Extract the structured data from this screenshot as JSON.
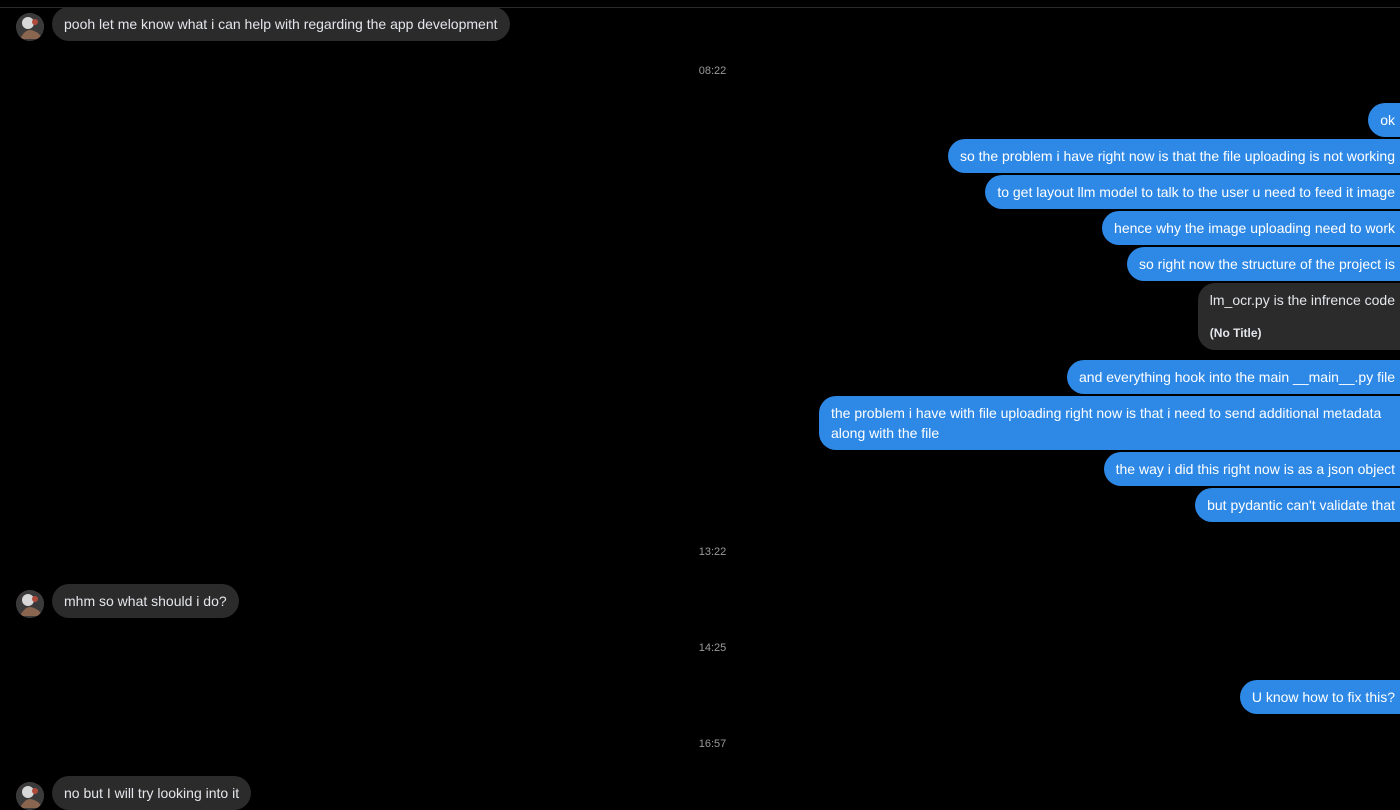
{
  "messages": [
    {
      "text": "pooh let me know what i can help with regarding the app development"
    },
    {
      "text": "ok"
    },
    {
      "text": "so the problem i have right now is that the file uploading is not working"
    },
    {
      "text": "to get layout llm model to talk to the user u need to feed it image"
    },
    {
      "text": "hence why the image uploading need to work"
    },
    {
      "text": "so right now the structure of the project is"
    },
    {
      "text": "lm_ocr.py is the infrence code",
      "attachment_title": "(No Title)"
    },
    {
      "text": "and everything hook into the main __main__.py file"
    },
    {
      "text": "the problem i have with file uploading right now is that i need to send additional metadata along with the file"
    },
    {
      "text": "the way i did this right now is as a json object"
    },
    {
      "text": "but pydantic can't validate that"
    },
    {
      "text": "mhm so what should i do?"
    },
    {
      "text": "U know how to fix this?"
    },
    {
      "text": "no but I will try looking into it"
    }
  ],
  "timestamps": [
    "08:22",
    "13:22",
    "14:25",
    "16:57"
  ],
  "icons": {
    "avatar": "contact-avatar-icon"
  },
  "colors": {
    "outgoing": "#2e89e6",
    "incoming": "#2b2b2b",
    "background": "#000000"
  }
}
